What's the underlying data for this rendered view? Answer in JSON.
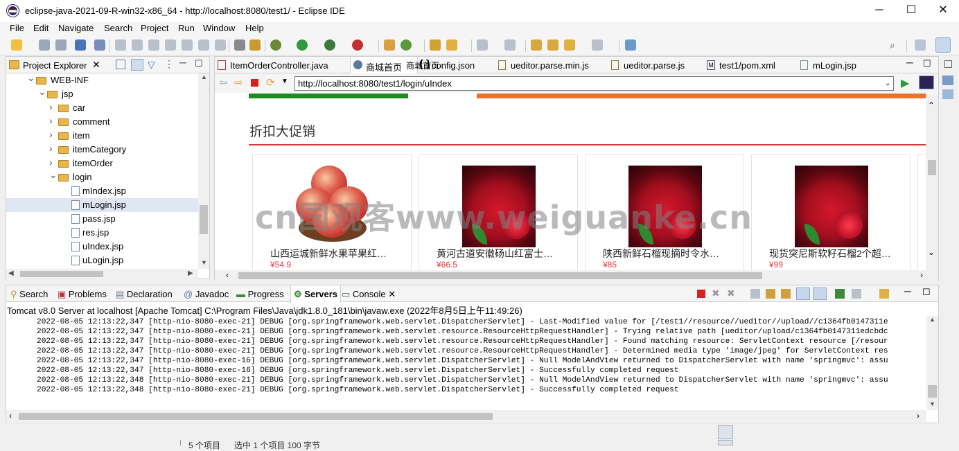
{
  "window": {
    "title": "eclipse-java-2021-09-R-win32-x86_64 - http://localhost:8080/test1/ - Eclipse IDE",
    "minimize": "─",
    "maximize": "☐",
    "close": "✕"
  },
  "menu": [
    "File",
    "Edit",
    "Navigate",
    "Search",
    "Project",
    "Run",
    "Window",
    "Help"
  ],
  "project_explorer": {
    "tab_label": "Project Explorer",
    "tree": [
      {
        "label": "WEB-INF",
        "kind": "folder",
        "depth": 0,
        "expanded": true
      },
      {
        "label": "jsp",
        "kind": "folder",
        "depth": 1,
        "expanded": true
      },
      {
        "label": "car",
        "kind": "folder",
        "depth": 2,
        "expanded": false
      },
      {
        "label": "comment",
        "kind": "folder",
        "depth": 2,
        "expanded": false
      },
      {
        "label": "item",
        "kind": "folder",
        "depth": 2,
        "expanded": false
      },
      {
        "label": "itemCategory",
        "kind": "folder",
        "depth": 2,
        "expanded": false
      },
      {
        "label": "itemOrder",
        "kind": "folder",
        "depth": 2,
        "expanded": false
      },
      {
        "label": "login",
        "kind": "folder",
        "depth": 2,
        "expanded": true
      },
      {
        "label": "mIndex.jsp",
        "kind": "file",
        "depth": 3
      },
      {
        "label": "mLogin.jsp",
        "kind": "file",
        "depth": 3,
        "selected": true
      },
      {
        "label": "pass.jsp",
        "kind": "file",
        "depth": 3
      },
      {
        "label": "res.jsp",
        "kind": "file",
        "depth": 3
      },
      {
        "label": "uIndex.jsp",
        "kind": "file",
        "depth": 3
      },
      {
        "label": "uLogin.jsp",
        "kind": "file",
        "depth": 3
      }
    ]
  },
  "editor": {
    "tabs": [
      {
        "label": "ItemOrderController.java",
        "active": false
      },
      {
        "label": "商城首页",
        "active": true
      },
      {
        "label": "config.json",
        "active": false
      },
      {
        "label": "ueditor.parse.min.js",
        "active": false
      },
      {
        "label": "ueditor.parse.js",
        "active": false
      },
      {
        "label": "test1/pom.xml",
        "active": false
      },
      {
        "label": "mLogin.jsp",
        "active": false
      }
    ],
    "tab_close": "✕",
    "url": "http://localhost:8080/test1/login/uIndex",
    "page": {
      "section_title": "折扣大促销",
      "accent_colors": {
        "green": "#1f8a1f",
        "orange": "#e8732c",
        "red_rule": "#d43a3a",
        "price": "#e4393c"
      },
      "products": [
        {
          "name": "山西运城新鲜水果苹果红…",
          "price": "¥54.9",
          "image": "apple"
        },
        {
          "name": "黄河古道安徽砀山红富士…",
          "price": "¥66.5",
          "image": "pomegranate"
        },
        {
          "name": "陕西新鲜石榴现摘时令水…",
          "price": "¥85",
          "image": "pomegranate"
        },
        {
          "name": "现货突尼斯软籽石榴2个超…",
          "price": "¥99",
          "image": "pomegranate"
        }
      ]
    }
  },
  "console": {
    "tabs": [
      {
        "label": "Search",
        "icon": "search-icon"
      },
      {
        "label": "Problems",
        "icon": "problems-icon"
      },
      {
        "label": "Declaration",
        "icon": "declaration-icon"
      },
      {
        "label": "Javadoc",
        "icon": "javadoc-icon"
      },
      {
        "label": "Progress",
        "icon": "progress-icon"
      },
      {
        "label": "Servers",
        "icon": "servers-icon",
        "active": true
      },
      {
        "label": "Console",
        "icon": "console-icon"
      }
    ],
    "server_line": "Tomcat v8.0 Server at localhost [Apache Tomcat] C:\\Program Files\\Java\\jdk1.8.0_181\\bin\\javaw.exe  (2022年8月5日上午11:49:26)",
    "lines": [
      "2022-08-05 12:13:22,347 [http-nio-8080-exec-21] DEBUG [org.springframework.web.servlet.DispatcherServlet] - Last-Modified value for [/test1//resource//ueditor//upload//c1364fb0147311e",
      "2022-08-05 12:13:22,347 [http-nio-8080-exec-21] DEBUG [org.springframework.web.servlet.resource.ResourceHttpRequestHandler] - Trying relative path [ueditor/upload/c1364fb0147311edcbdc",
      "2022-08-05 12:13:22,347 [http-nio-8080-exec-21] DEBUG [org.springframework.web.servlet.resource.ResourceHttpRequestHandler] - Found matching resource: ServletContext resource [/resour",
      "2022-08-05 12:13:22,347 [http-nio-8080-exec-21] DEBUG [org.springframework.web.servlet.resource.ResourceHttpRequestHandler] - Determined media type 'image/jpeg' for ServletContext res",
      "2022-08-05 12:13:22,347 [http-nio-8080-exec-16] DEBUG [org.springframework.web.servlet.DispatcherServlet] - Null ModelAndView returned to DispatcherServlet with name 'springmvc': assu",
      "2022-08-05 12:13:22,347 [http-nio-8080-exec-16] DEBUG [org.springframework.web.servlet.DispatcherServlet] - Successfully completed request",
      "2022-08-05 12:13:22,348 [http-nio-8080-exec-21] DEBUG [org.springframework.web.servlet.DispatcherServlet] - Null ModelAndView returned to DispatcherServlet with name 'springmvc': assu",
      "2022-08-05 12:13:22,348 [http-nio-8080-exec-21] DEBUG [org.springframework.web.servlet.DispatcherServlet] - Successfully completed request"
    ]
  },
  "statusbar": {
    "items_text": "5 个项目",
    "selected_text": "选中 1 个项目  100 字节"
  },
  "watermark": "cn国观客www.weiguanke.cn"
}
